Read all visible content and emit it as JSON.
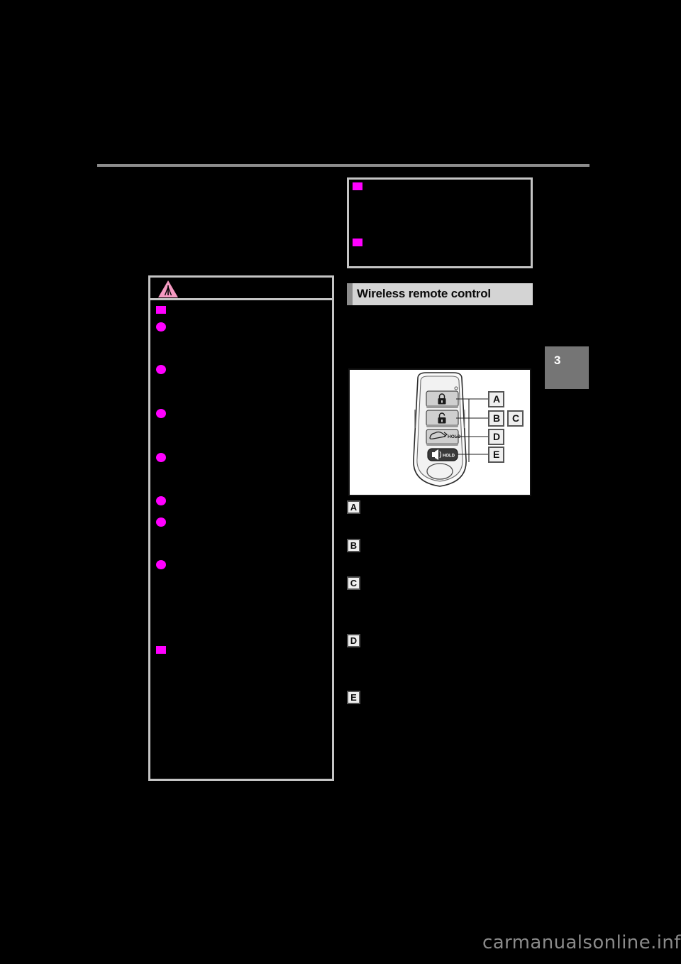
{
  "page": {
    "chapter_number": "3",
    "watermark": "carmanualsonline.info",
    "background_color": "#000000",
    "rule_color": "#8c8c8c",
    "bullet_color": "#ff00ff",
    "box_border_color": "#c4c4c4"
  },
  "left_column": {
    "warning_box": {
      "icon": "warning-triangle-icon",
      "icon_color": "#f49ac1",
      "items": [
        {
          "type": "square-bullet",
          "text": ""
        },
        {
          "type": "round-bullet",
          "text": ""
        },
        {
          "type": "round-bullet",
          "text": ""
        },
        {
          "type": "round-bullet",
          "text": ""
        },
        {
          "type": "round-bullet",
          "text": ""
        },
        {
          "type": "round-bullet",
          "text": ""
        },
        {
          "type": "round-bullet",
          "text": ""
        },
        {
          "type": "square-bullet",
          "text": ""
        }
      ]
    }
  },
  "right_column": {
    "notice_box": {
      "items": [
        {
          "type": "square-bullet",
          "text": ""
        },
        {
          "type": "square-bullet",
          "text": ""
        }
      ]
    },
    "section_heading": {
      "label": "Wireless remote control",
      "background_color": "#d4d4d4",
      "bar_color": "#8c8c8c"
    },
    "figure": {
      "name": "wireless-remote-control-key-fob",
      "buttons": [
        {
          "marker": "A",
          "icon": "lock-icon",
          "icon_label": ""
        },
        {
          "marker": "B",
          "icon": "unlock-icon",
          "icon_label": ""
        },
        {
          "marker": "D",
          "icon": "trunk-icon",
          "icon_label": "HOLD"
        },
        {
          "marker": "E",
          "icon": "panic-alarm-icon",
          "icon_label": "HOLD"
        }
      ],
      "markers": [
        "A",
        "B",
        "C",
        "D",
        "E"
      ]
    },
    "callouts": [
      {
        "marker": "A",
        "text": ""
      },
      {
        "marker": "B",
        "text": ""
      },
      {
        "marker": "C",
        "text": ""
      },
      {
        "marker": "D",
        "text": ""
      },
      {
        "marker": "E",
        "text": ""
      }
    ]
  }
}
